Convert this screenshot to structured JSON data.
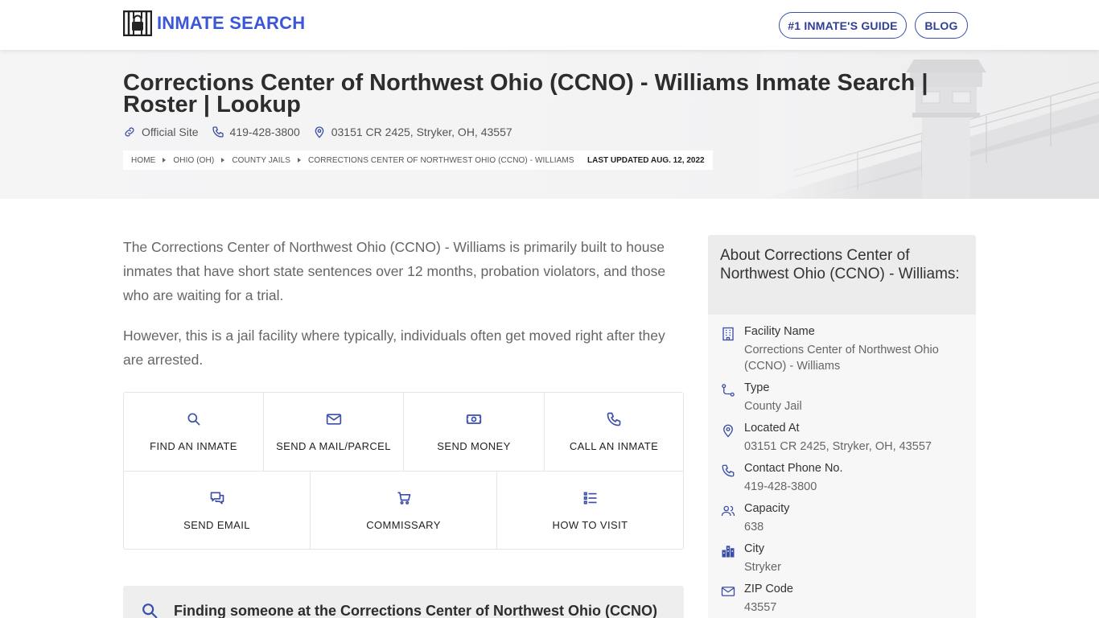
{
  "header": {
    "logo_text": "INMATE SEARCH",
    "nav": [
      {
        "label": "#1 INMATE'S GUIDE"
      },
      {
        "label": "BLOG"
      }
    ]
  },
  "hero": {
    "title": "Corrections Center of Northwest Ohio (CCNO) - Williams Inmate Search | Roster | Lookup",
    "official_site": "Official Site",
    "phone": "419-428-3800",
    "address": "03151 CR 2425, Stryker, OH, 43557",
    "breadcrumbs": [
      "HOME",
      "OHIO (OH)",
      "COUNTY JAILS",
      "CORRECTIONS CENTER OF NORTHWEST OHIO (CCNO) - WILLIAMS"
    ],
    "last_updated": "LAST UPDATED AUG. 12, 2022"
  },
  "intro": {
    "paragraphs": [
      "The Corrections Center of Northwest Ohio (CCNO) - Williams is primarily built to house inmates that have short state sentences over 12 months, probation violators, and those who are waiting for a trial.",
      "However, this is a jail facility where typically, individuals often get moved right after they are arrested."
    ]
  },
  "actions": [
    {
      "label": "FIND AN INMATE",
      "icon": "search-icon"
    },
    {
      "label": "SEND A MAIL/PARCEL",
      "icon": "mail-icon"
    },
    {
      "label": "SEND MONEY",
      "icon": "money-icon"
    },
    {
      "label": "CALL AN INMATE",
      "icon": "phone-icon"
    },
    {
      "label": "SEND EMAIL",
      "icon": "chat-icon"
    },
    {
      "label": "COMMISSARY",
      "icon": "cart-icon"
    },
    {
      "label": "HOW TO VISIT",
      "icon": "list-icon"
    }
  ],
  "finding": {
    "text": "Finding someone at the Corrections Center of Northwest Ohio (CCNO)"
  },
  "sidebar": {
    "title": "About Corrections Center of Northwest Ohio (CCNO) - Williams:",
    "facts": [
      {
        "label": "Facility Name",
        "value": "Corrections Center of Northwest Ohio (CCNO) - Williams",
        "icon": "building-icon"
      },
      {
        "label": "Type",
        "value": "County Jail",
        "icon": "route-icon"
      },
      {
        "label": "Located At",
        "value": "03151 CR 2425, Stryker, OH, 43557",
        "icon": "map-pin-icon"
      },
      {
        "label": "Contact Phone No.",
        "value": "419-428-3800",
        "icon": "phone-icon"
      },
      {
        "label": "Capacity",
        "value": "638",
        "icon": "users-icon"
      },
      {
        "label": "City",
        "value": "Stryker",
        "icon": "city-icon"
      },
      {
        "label": "ZIP Code",
        "value": "43557",
        "icon": "mail-icon"
      }
    ]
  },
  "colors": {
    "brand": "#3b57d6",
    "nav_border": "#3b4ea8",
    "icon": "#3b4ea8"
  }
}
